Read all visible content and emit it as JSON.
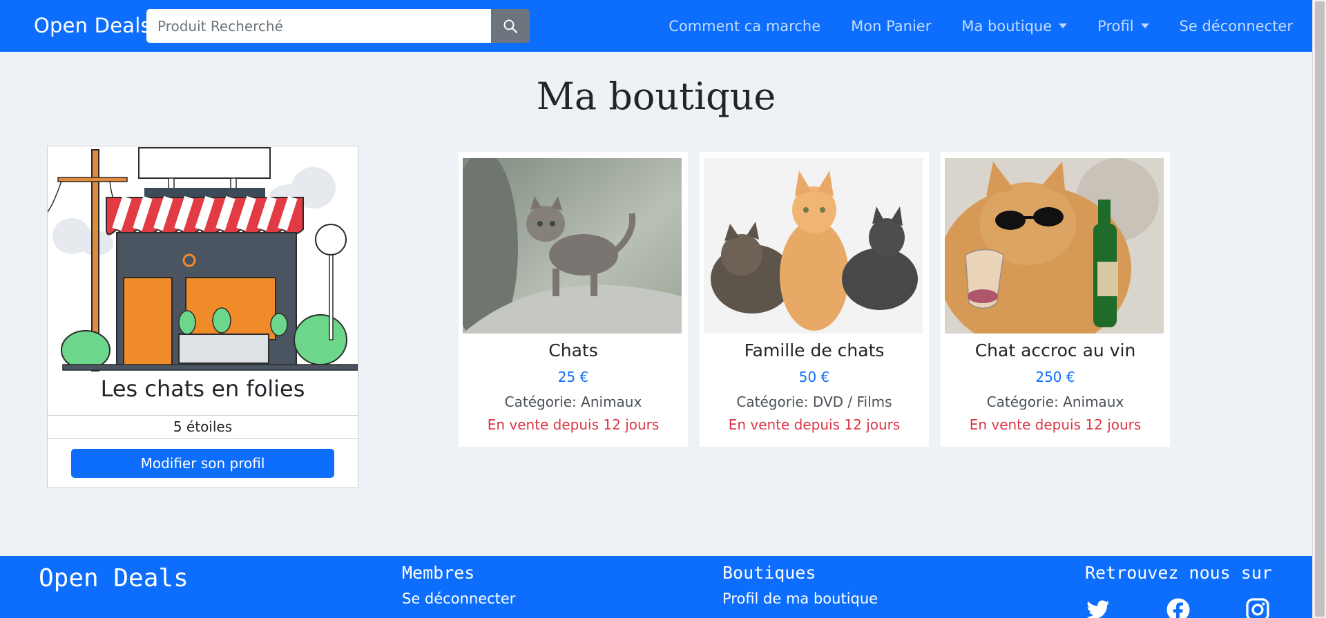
{
  "navbar": {
    "brand": "Open Deals",
    "search_placeholder": "Produit Recherché",
    "search_icon": "search-icon",
    "links": [
      {
        "label": "Comment ca marche",
        "dropdown": false
      },
      {
        "label": "Mon Panier",
        "dropdown": false
      },
      {
        "label": "Ma boutique",
        "dropdown": true
      },
      {
        "label": "Profil",
        "dropdown": true
      },
      {
        "label": "Se déconnecter",
        "dropdown": false
      }
    ]
  },
  "page": {
    "title": "Ma boutique"
  },
  "shop": {
    "name": "Les chats en folies",
    "rating": "5 étoiles",
    "edit_button": "Modifier son profil",
    "image_icon": "storefront-illustration"
  },
  "products": [
    {
      "name": "Chats",
      "price": "25 €",
      "category": "Catégorie: Animaux",
      "since": "En vente depuis 12 jours"
    },
    {
      "name": "Famille de chats",
      "price": "50 €",
      "category": "Catégorie: DVD / Films",
      "since": "En vente depuis 12 jours"
    },
    {
      "name": "Chat accroc au vin",
      "price": "250 €",
      "category": "Catégorie: Animaux",
      "since": "En vente depuis 12 jours"
    }
  ],
  "footer": {
    "brand": "Open Deals",
    "members_title": "Membres",
    "members_link": "Se déconnecter",
    "shops_title": "Boutiques",
    "shops_link": "Profil de ma boutique",
    "social_title": "Retrouvez nous sur",
    "social_icons": [
      "twitter-icon",
      "facebook-icon",
      "instagram-icon"
    ]
  },
  "colors": {
    "primary": "#0d6efd",
    "background": "#eef2f6",
    "price": "#0d6efd",
    "since": "#dc3545",
    "search_button": "#6c757d"
  }
}
